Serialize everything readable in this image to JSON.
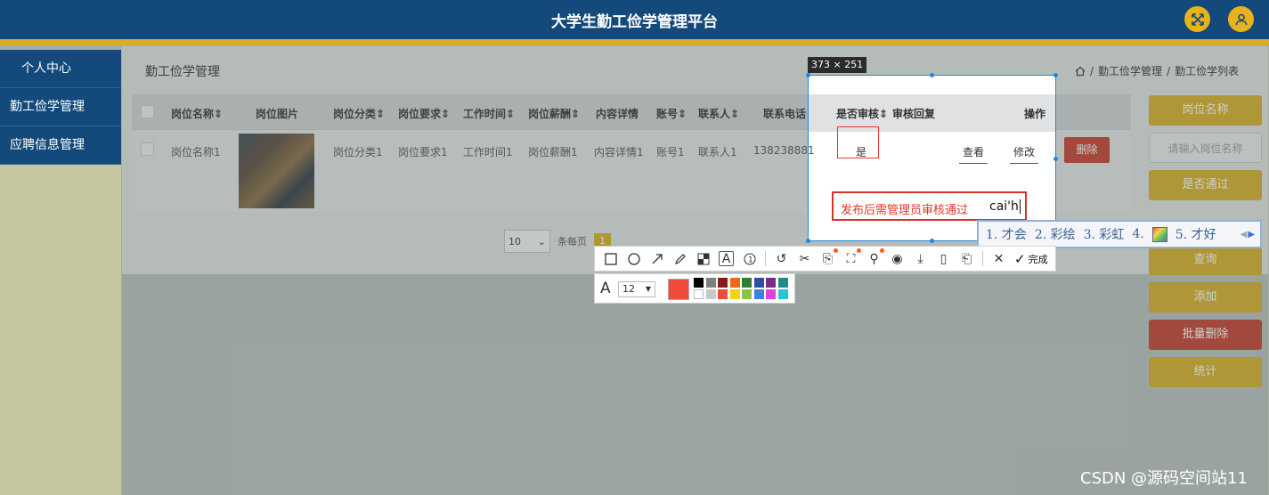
{
  "header": {
    "title": "大学生勤工俭学管理平台",
    "fullscreen_icon": "expand-icon",
    "user_icon": "user-icon"
  },
  "sidebar": {
    "items": [
      {
        "label": "个人中心"
      },
      {
        "label": "勤工俭学管理"
      },
      {
        "label": "应聘信息管理"
      }
    ]
  },
  "page": {
    "title": "勤工俭学管理",
    "breadcrumb": [
      "勤工俭学管理",
      "勤工俭学列表"
    ],
    "breadcrumb_sep": "/"
  },
  "table": {
    "headers": [
      "岗位名称⇕",
      "岗位图片",
      "岗位分类⇕",
      "岗位要求⇕",
      "工作时间⇕",
      "岗位薪酬⇕",
      "内容详情",
      "账号⇕",
      "联系人⇕",
      "联系电话⇕",
      "是否审核⇕",
      "审核回复",
      "操作"
    ],
    "row": {
      "name": "岗位名称1",
      "category": "岗位分类1",
      "requirement": "岗位要求1",
      "time": "工作时间1",
      "salary": "岗位薪酬1",
      "detail": "内容详情1",
      "account": "账号1",
      "contact": "联系人1",
      "phone": "13823888881",
      "audit": "是",
      "view": "查看",
      "edit": "修改",
      "delete": "删除"
    }
  },
  "pager": {
    "per_page": "10",
    "per_page_suffix": "条每页",
    "current": "1"
  },
  "right_panel": {
    "name_label": "岗位名称",
    "name_placeholder": "请输入岗位名称",
    "pass_label": "是否通过",
    "query": "查询",
    "add": "添加",
    "batch_delete": "批量删除",
    "stats": "统计"
  },
  "capture": {
    "size": "373 × 251",
    "annotation_text": "发布后需管理员审核通过",
    "typing": "cai'h",
    "ime_candidates": [
      "1. 才会",
      "2. 彩绘",
      "3. 彩虹",
      "4.",
      "5. 才好"
    ],
    "done_label": "完成",
    "font_size": "12",
    "colors": {
      "current": "#f24a3a",
      "palette_top": [
        "#000000",
        "#7f7f7f",
        "#8a1a1a",
        "#e86a1a",
        "#2e7d32",
        "#2a4fa8",
        "#7b2a8a",
        "#1e8a8a"
      ],
      "palette_bottom": [
        "#ffffff",
        "#c8c8c8",
        "#f24a3a",
        "#f5d313",
        "#8bc34a",
        "#3f7fe0",
        "#e040e0",
        "#26c6da"
      ]
    }
  },
  "watermark": "CSDN @源码空间站11"
}
